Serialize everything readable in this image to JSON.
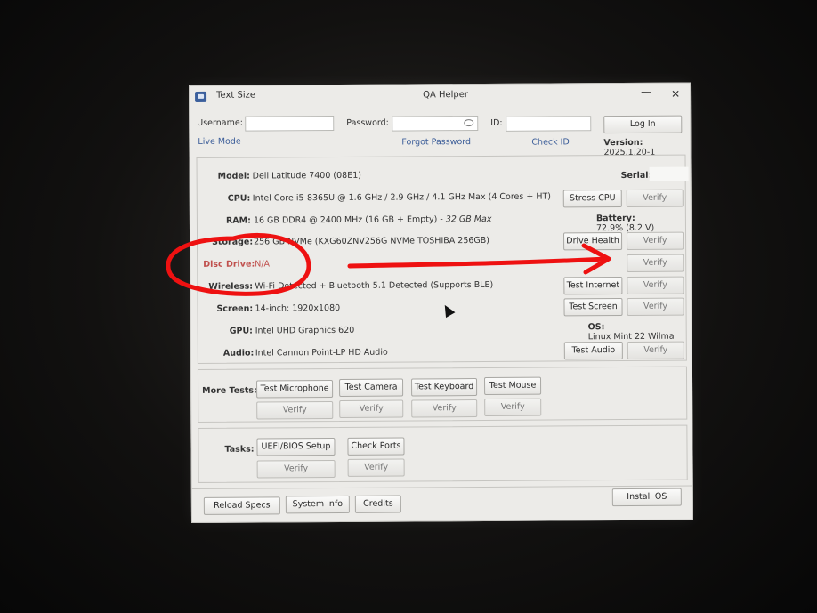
{
  "window": {
    "menu_text_size": "Text Size",
    "title": "QA Helper",
    "minimize": "—",
    "close": "✕"
  },
  "header": {
    "username_label": "Username:",
    "username_value": "",
    "password_label": "Password:",
    "password_value": "",
    "id_label": "ID:",
    "id_value": "",
    "login_button": "Log In",
    "live_mode": "Live Mode",
    "forgot_password": "Forgot Password",
    "check_id": "Check ID",
    "version_label": "Version:",
    "version_value": "2025.1.20-1"
  },
  "specs": {
    "model": {
      "label": "Model:",
      "value": "Dell Latitude 7400 (08E1)"
    },
    "serial": {
      "label": "Serial:",
      "value": ""
    },
    "cpu": {
      "label": "CPU:",
      "value": "Intel Core i5-8365U @ 1.6 GHz / 2.9 GHz / 4.1 GHz Max (4 Cores + HT)",
      "test": "Stress CPU",
      "verify": "Verify"
    },
    "ram": {
      "label": "RAM:",
      "value": "16 GB DDR4 @ 2400 MHz (16 GB + Empty) - ",
      "value_italic": "32 GB Max"
    },
    "battery": {
      "label": "Battery:",
      "value": "72.9% (8.2 V)"
    },
    "storage": {
      "label": "Storage:",
      "value": "256 GB NVMe (KXG60ZNV256G NVMe TOSHIBA 256GB)",
      "test": "Drive Health",
      "verify": "Verify"
    },
    "disc": {
      "label": "Disc Drive:",
      "value": "N/A",
      "verify": "Verify"
    },
    "wireless": {
      "label": "Wireless:",
      "value": "Wi-Fi Detected + Bluetooth 5.1 Detected (Supports BLE)",
      "test": "Test Internet",
      "verify": "Verify"
    },
    "screen": {
      "label": "Screen:",
      "value": "14-inch: 1920x1080",
      "test": "Test Screen",
      "verify": "Verify"
    },
    "gpu": {
      "label": "GPU:",
      "value": "Intel UHD Graphics 620"
    },
    "os": {
      "label": "OS:",
      "value": "Linux Mint 22 Wilma"
    },
    "audio": {
      "label": "Audio:",
      "value": "Intel Cannon Point-LP HD Audio",
      "test": "Test Audio",
      "verify": "Verify"
    }
  },
  "more_tests": {
    "label": "More Tests:",
    "buttons": [
      "Test Microphone",
      "Test Camera",
      "Test Keyboard",
      "Test Mouse"
    ],
    "verify": "Verify"
  },
  "tasks": {
    "label": "Tasks:",
    "buttons": [
      "UEFI/BIOS Setup",
      "Check Ports"
    ],
    "verify": "Verify"
  },
  "footer": {
    "reload_specs": "Reload Specs",
    "system_info": "System Info",
    "credits": "Credits",
    "install_os": "Install OS"
  },
  "colors": {
    "window_bg": "#ecebe8",
    "link": "#3a5c98",
    "disc_warning": "#c0504d",
    "annotation": "#ee1111"
  }
}
